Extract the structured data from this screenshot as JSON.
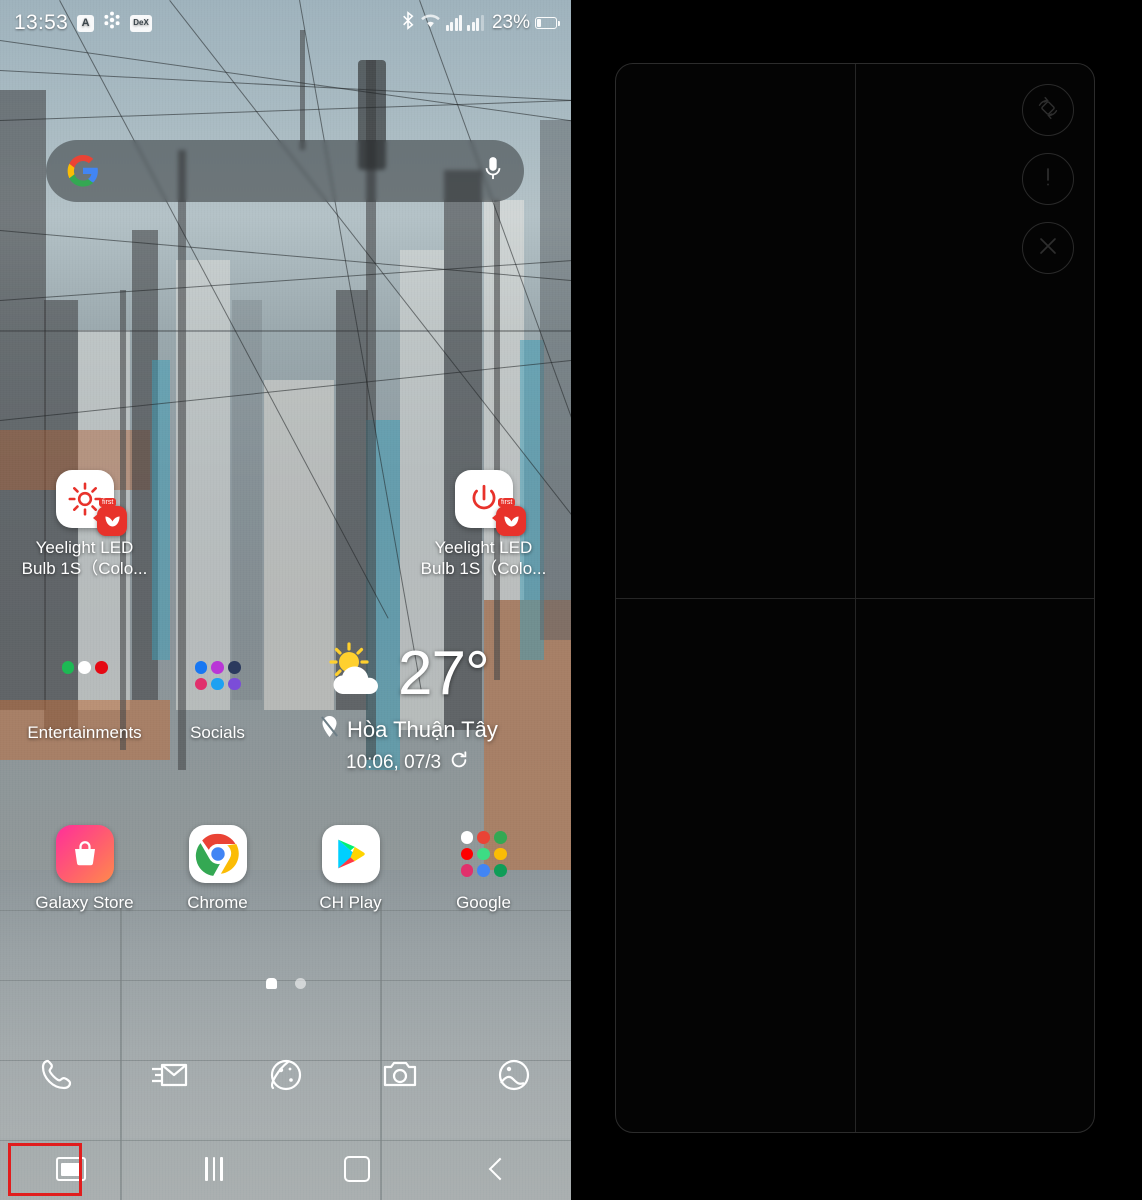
{
  "statusbar": {
    "clock": "13:53",
    "left_icons": [
      "A",
      "bluetooth-share-icon",
      "DeX"
    ],
    "right_icons": [
      "bluetooth-icon",
      "wifi-icon",
      "signal-icon",
      "signal-icon"
    ],
    "battery_percent": "23%"
  },
  "search": {
    "placeholder": "",
    "logo": "google-g-icon",
    "mic": "microphone-icon"
  },
  "home": {
    "shortcuts": [
      {
        "label": "Yeelight LED\nBulb 1S（Colo...",
        "icon": "brightness-sun-icon",
        "badge": "yeelight-badge",
        "badge_tag": "first"
      },
      {
        "label": "Yeelight LED\nBulb 1S（Colo...",
        "icon": "power-icon",
        "badge": "yeelight-badge",
        "badge_tag": "first"
      }
    ],
    "folders": [
      {
        "label": "Entertainments",
        "apps": [
          "spotify-icon",
          "youtube-music-icon",
          "netflix-icon"
        ]
      },
      {
        "label": "Socials",
        "apps": [
          "facebook-icon",
          "instagram-icon",
          "twitter-icon",
          "messenger-icon",
          "viber-icon",
          "zalo-icon"
        ]
      }
    ],
    "apps": [
      {
        "label": "Galaxy Store",
        "icon": "galaxy-store-icon"
      },
      {
        "label": "Chrome",
        "icon": "chrome-icon"
      },
      {
        "label": "CH Play",
        "icon": "play-store-icon"
      },
      {
        "label": "Google",
        "icon": "google-folder-icon"
      }
    ],
    "page_dots": [
      "home-dot",
      "page-dot"
    ]
  },
  "weather": {
    "temperature": "27°",
    "location": "Hòa Thuận Tây",
    "updated": "10:06, 07/3",
    "condition_icon": "partly-cloudy-icon",
    "location_icon": "location-pin-icon",
    "refresh_icon": "refresh-icon"
  },
  "dock": [
    {
      "label": "Phone",
      "icon": "phone-icon"
    },
    {
      "label": "Messages",
      "icon": "mail-icon"
    },
    {
      "label": "Internet",
      "icon": "browser-planet-icon"
    },
    {
      "label": "Camera",
      "icon": "camera-icon"
    },
    {
      "label": "Gallery",
      "icon": "gallery-icon"
    }
  ],
  "navbar": [
    {
      "label": "Multi window",
      "icon": "multi-window-icon",
      "highlighted": true
    },
    {
      "label": "Recents",
      "icon": "recents-icon",
      "highlighted": false
    },
    {
      "label": "Home",
      "icon": "home-icon",
      "highlighted": false
    },
    {
      "label": "Back",
      "icon": "back-icon",
      "highlighted": false
    }
  ],
  "right_panel": {
    "buttons": [
      {
        "label": "Rotate",
        "icon": "rotate-icon"
      },
      {
        "label": "Info",
        "icon": "exclamation-icon"
      },
      {
        "label": "Close",
        "icon": "close-x-icon"
      }
    ]
  },
  "colors": {
    "accent_red": "#e11d1d",
    "badge_red": "#e8322b",
    "panel_border": "#2c2c2c"
  }
}
